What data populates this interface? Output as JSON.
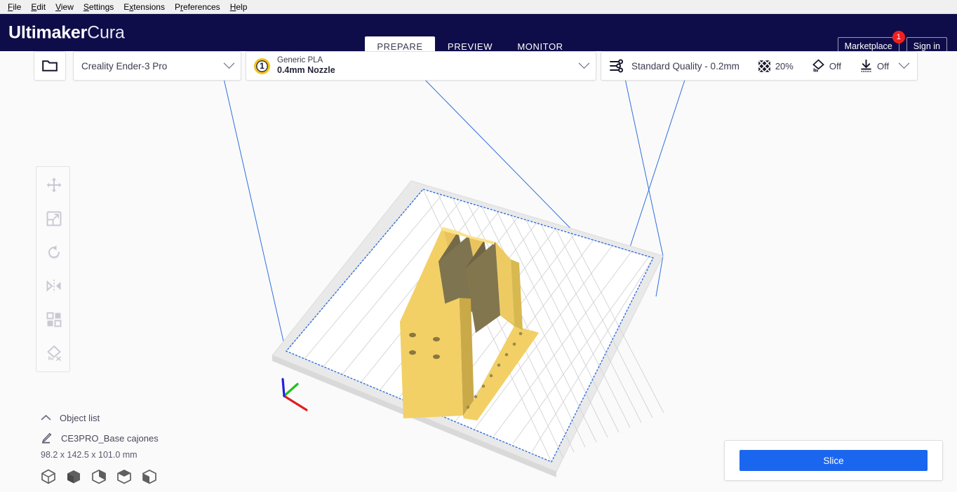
{
  "menubar": {
    "items": [
      {
        "label": "File",
        "mnemonic": "F"
      },
      {
        "label": "Edit",
        "mnemonic": "E"
      },
      {
        "label": "View",
        "mnemonic": "V"
      },
      {
        "label": "Settings",
        "mnemonic": "S"
      },
      {
        "label": "Extensions",
        "mnemonic": "x"
      },
      {
        "label": "Preferences",
        "mnemonic": "r"
      },
      {
        "label": "Help",
        "mnemonic": "H"
      }
    ]
  },
  "header": {
    "brand_bold": "Ultimaker",
    "brand_light": "Cura",
    "background_color": "#0f0d49",
    "tabs": [
      {
        "label": "PREPARE",
        "active": true
      },
      {
        "label": "PREVIEW",
        "active": false
      },
      {
        "label": "MONITOR",
        "active": false
      }
    ],
    "marketplace_label": "Marketplace",
    "marketplace_badge": "1",
    "badge_color": "#f02020",
    "signin_label": "Sign in"
  },
  "toolbar": {
    "open_file_icon": "folder-icon",
    "printer": {
      "name": "Creality Ender-3 Pro",
      "chevron": "chevron-down-icon"
    },
    "material": {
      "extruder_number": "1",
      "material_name": "Generic PLA",
      "nozzle": "0.4mm Nozzle",
      "chevron": "chevron-down-icon"
    },
    "print_settings": {
      "profile_icon": "sliders-icon",
      "profile": "Standard Quality - 0.2mm",
      "infill_icon": "infill-icon",
      "infill_value": "20%",
      "support_icon": "support-icon",
      "support_value": "Off",
      "adhesion_icon": "adhesion-icon",
      "adhesion_value": "Off",
      "chevron": "chevron-down-icon"
    }
  },
  "tools": [
    {
      "name": "move-tool",
      "icon": "move-icon"
    },
    {
      "name": "scale-tool",
      "icon": "scale-icon"
    },
    {
      "name": "rotate-tool",
      "icon": "rotate-icon"
    },
    {
      "name": "mirror-tool",
      "icon": "mirror-icon"
    },
    {
      "name": "per-model-settings-tool",
      "icon": "per-model-settings-icon"
    },
    {
      "name": "support-blocker-tool",
      "icon": "support-blocker-icon"
    }
  ],
  "object_list": {
    "collapse_icon": "chevron-up-icon",
    "title": "Object list",
    "edit_icon": "pencil-icon",
    "object_name": "CE3PRO_Base cajones",
    "dimensions": "98.2 x 142.5 x 101.0 mm",
    "view_cubes": [
      {
        "name": "view-cube-3d",
        "label": "3D view"
      },
      {
        "name": "view-cube-front",
        "label": "Front view"
      },
      {
        "name": "view-cube-top",
        "label": "Top view"
      },
      {
        "name": "view-cube-left",
        "label": "Left view"
      },
      {
        "name": "view-cube-right",
        "label": "Right view"
      }
    ]
  },
  "action_panel": {
    "slice_label": "Slice",
    "slice_color": "#1b66ee"
  },
  "viewport": {
    "background_color": "#fafafa",
    "build_plate_grid_color": "#d6d6d6",
    "build_volume_outline_color": "#2f6fe0",
    "model_color_light": "#f2cf66",
    "model_color_mid": "#e3c155",
    "model_color_dark": "#7b7050",
    "axis_x_color": "#e02020",
    "axis_y_color": "#20c020",
    "axis_z_color": "#2020e0"
  }
}
